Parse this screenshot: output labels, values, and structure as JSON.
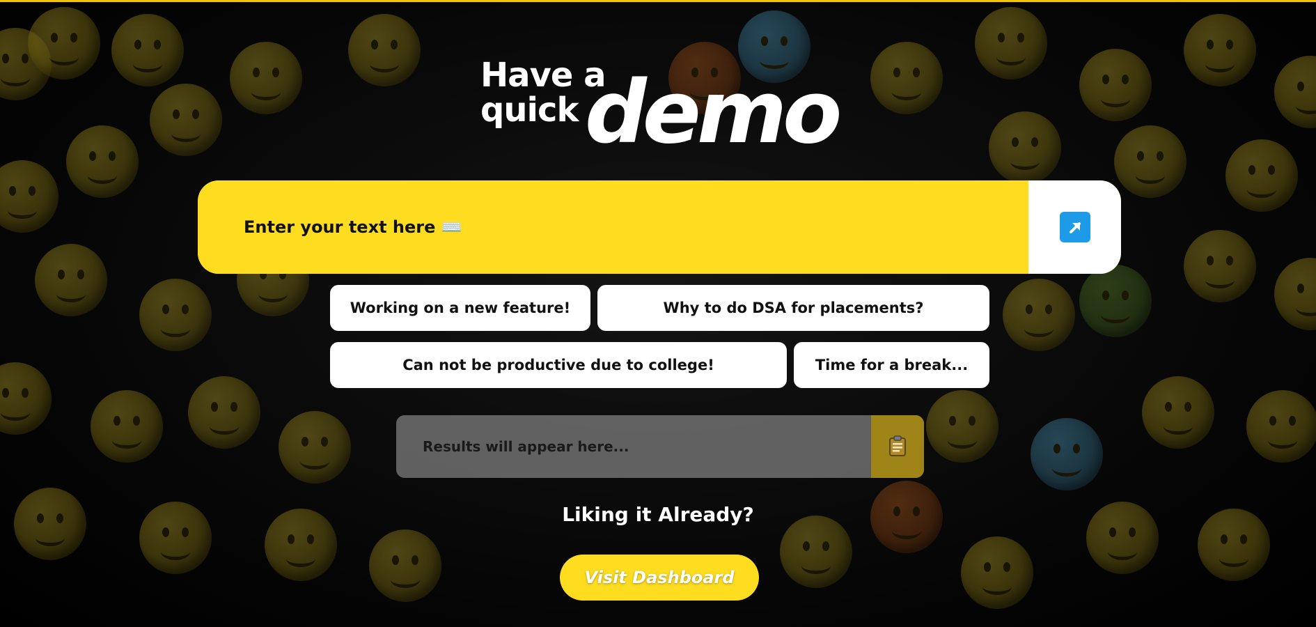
{
  "hero": {
    "line1": "Have a",
    "line2": "quick",
    "big_word": "demo"
  },
  "search": {
    "placeholder": "Enter your text here ⌨️",
    "submit_icon": "arrow-up-right-icon",
    "accent_color": "#fedd21",
    "icon_color": "#1e9be8"
  },
  "suggestions": [
    "Working on a new feature!",
    "Why to do DSA for placements?",
    "Can not be productive due to college!",
    "Time for a break..."
  ],
  "results": {
    "placeholder": "Results will appear here...",
    "copy_icon": "clipboard-icon"
  },
  "cta": {
    "heading": "Liking it Already?",
    "button_label": "Visit Dashboard"
  },
  "colors": {
    "top_border": "#f4c400",
    "background": "#000000"
  }
}
